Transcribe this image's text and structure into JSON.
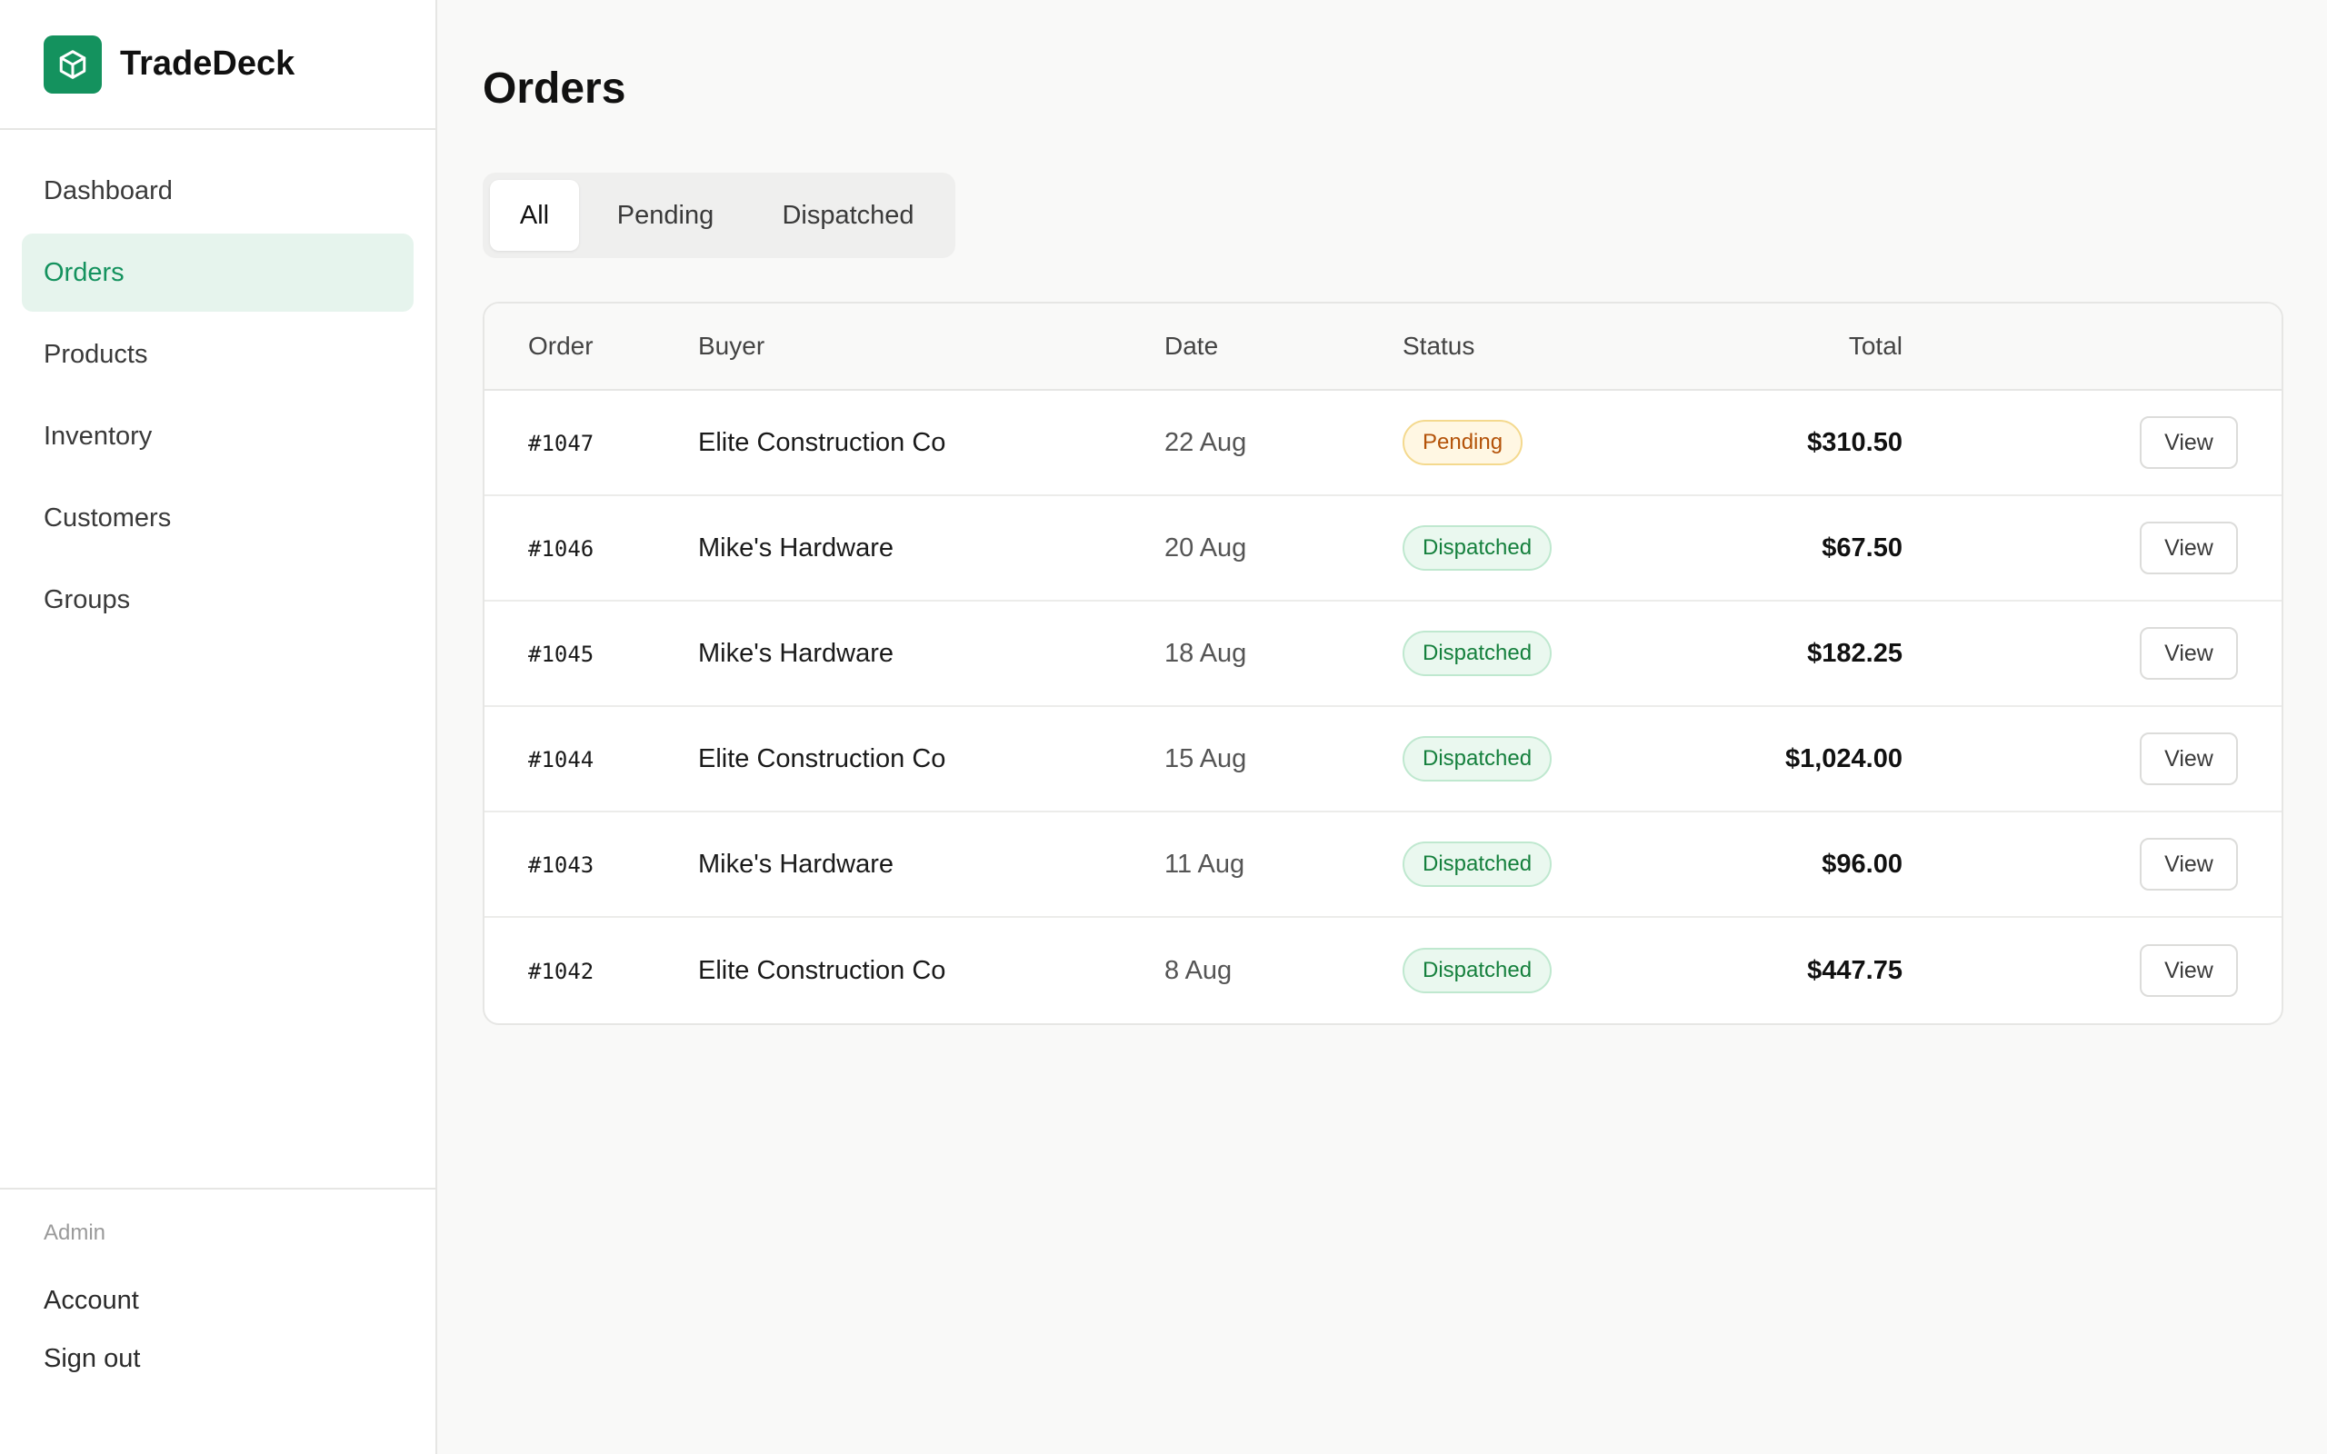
{
  "brand": {
    "name": "TradeDeck",
    "logo_icon": "box-icon",
    "accent": "#14925e"
  },
  "nav": {
    "items": [
      {
        "label": "Dashboard",
        "active": false
      },
      {
        "label": "Orders",
        "active": true
      },
      {
        "label": "Products",
        "active": false
      },
      {
        "label": "Inventory",
        "active": false
      },
      {
        "label": "Customers",
        "active": false
      },
      {
        "label": "Groups",
        "active": false
      }
    ]
  },
  "footer": {
    "section_label": "Admin",
    "links": [
      "Account",
      "Sign out"
    ]
  },
  "page": {
    "title": "Orders"
  },
  "tabs": [
    {
      "label": "All",
      "active": true
    },
    {
      "label": "Pending",
      "active": false
    },
    {
      "label": "Dispatched",
      "active": false
    }
  ],
  "table": {
    "headers": {
      "order": "Order",
      "buyer": "Buyer",
      "date": "Date",
      "status": "Status",
      "total": "Total"
    },
    "action_label": "View",
    "rows": [
      {
        "order": "#1047",
        "buyer": "Elite Construction Co",
        "date": "22 Aug",
        "status": "Pending",
        "total": "$310.50"
      },
      {
        "order": "#1046",
        "buyer": "Mike's Hardware",
        "date": "20 Aug",
        "status": "Dispatched",
        "total": "$67.50"
      },
      {
        "order": "#1045",
        "buyer": "Mike's Hardware",
        "date": "18 Aug",
        "status": "Dispatched",
        "total": "$182.25"
      },
      {
        "order": "#1044",
        "buyer": "Elite Construction Co",
        "date": "15 Aug",
        "status": "Dispatched",
        "total": "$1,024.00"
      },
      {
        "order": "#1043",
        "buyer": "Mike's Hardware",
        "date": "11 Aug",
        "status": "Dispatched",
        "total": "$96.00"
      },
      {
        "order": "#1042",
        "buyer": "Elite Construction Co",
        "date": "8 Aug",
        "status": "Dispatched",
        "total": "$447.75"
      }
    ]
  },
  "colors": {
    "pending_text": "#b45309",
    "dispatched_text": "#15803d",
    "active_nav_bg": "#e6f4ed"
  }
}
